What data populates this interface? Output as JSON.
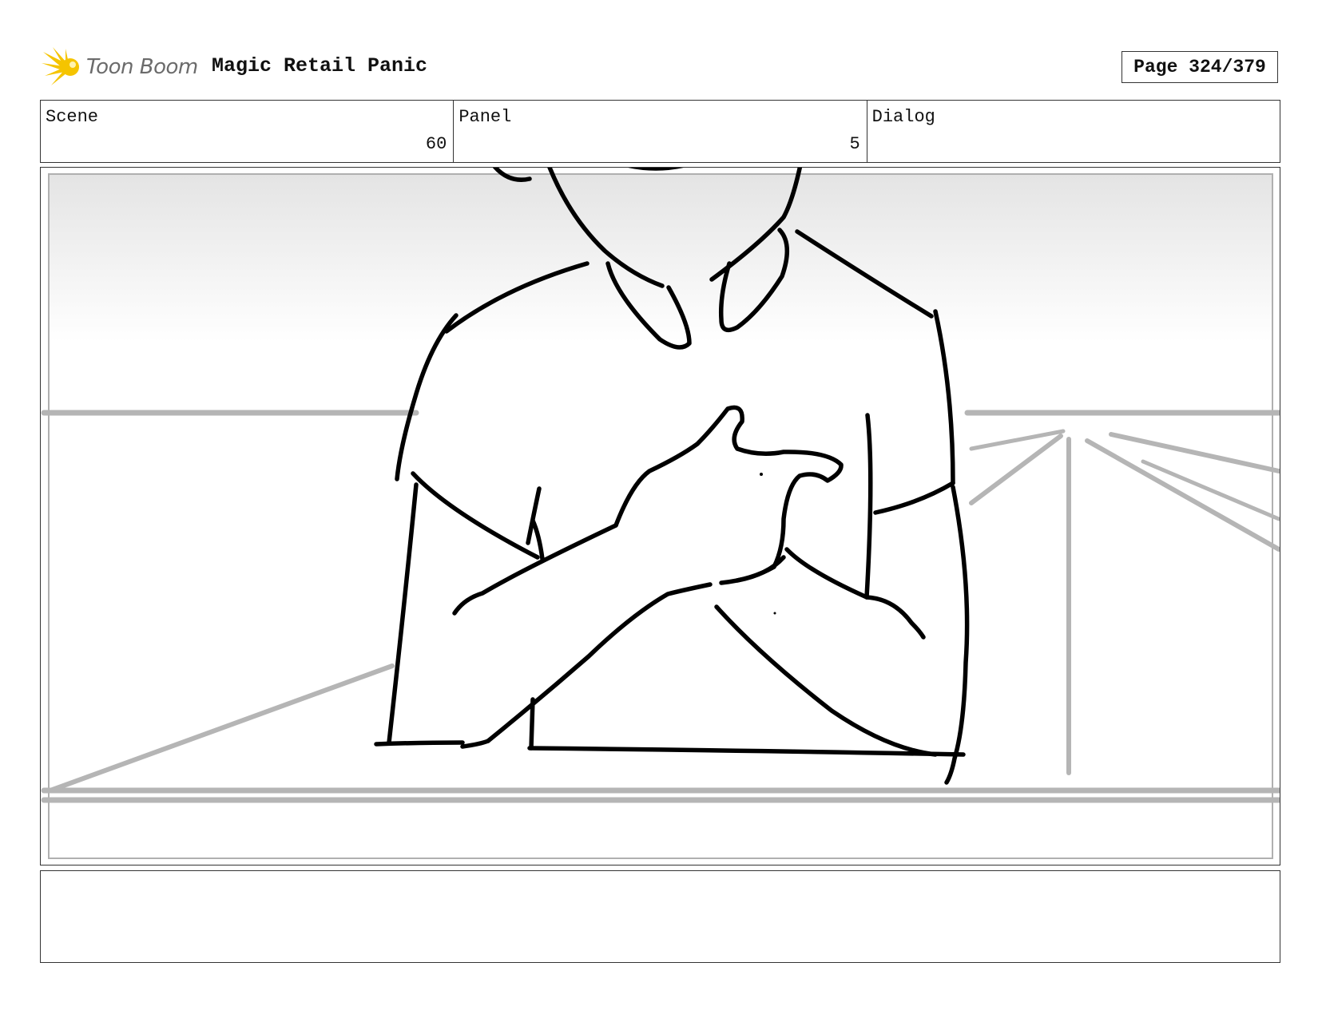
{
  "header": {
    "logo_text": "Toon Boom",
    "project_title": "Magic Retail Panic",
    "page_label": "Page 324/379"
  },
  "info": {
    "scene_label": "Scene",
    "scene_value": "60",
    "panel_label": "Panel",
    "panel_value": "5",
    "dialog_label": "Dialog",
    "dialog_value": ""
  },
  "notes": {
    "text": ""
  },
  "colors": {
    "logo_star": "#f5c400",
    "logo_text": "#6b6b6b",
    "border": "#333333",
    "sketch_ink": "#000000",
    "background_lines": "#b5b5b5"
  }
}
